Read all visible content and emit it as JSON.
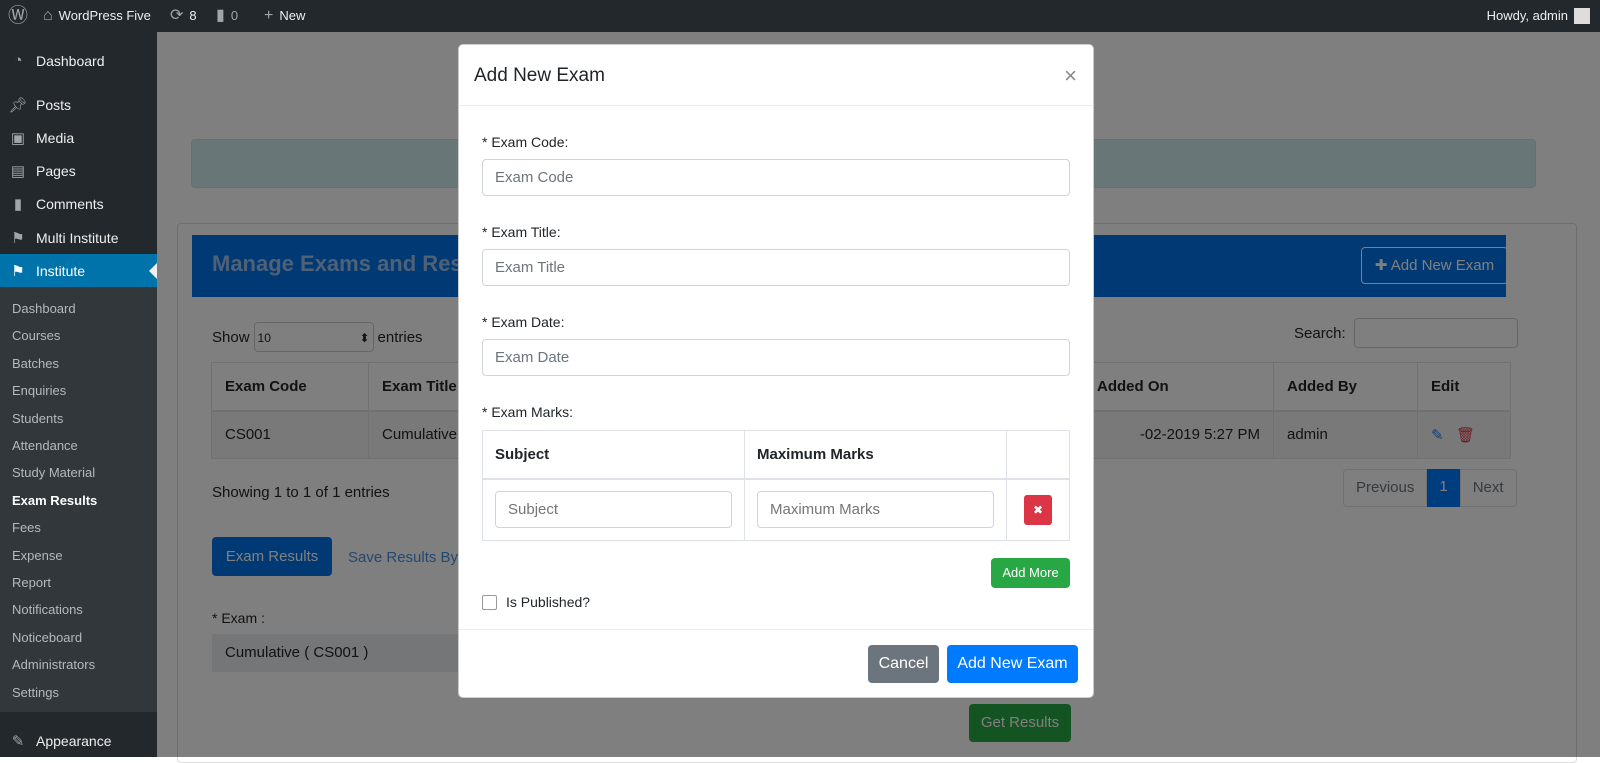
{
  "adminbar": {
    "site": "WordPress Five",
    "updates": "8",
    "comments": "0",
    "new": "New",
    "howdy": "Howdy, admin"
  },
  "sidebar": {
    "items": [
      {
        "label": "Dashboard",
        "icon": "gauge-icon"
      },
      {
        "label": "Posts",
        "icon": "pin-icon"
      },
      {
        "label": "Media",
        "icon": "media-icon"
      },
      {
        "label": "Pages",
        "icon": "pages-icon"
      },
      {
        "label": "Comments",
        "icon": "comment-icon"
      },
      {
        "label": "Multi Institute",
        "icon": "graduation-cap-icon"
      },
      {
        "label": "Institute",
        "icon": "graduation-cap-icon"
      }
    ],
    "submenu": [
      "Dashboard",
      "Courses",
      "Batches",
      "Enquiries",
      "Students",
      "Attendance",
      "Study Material",
      "Exam Results",
      "Fees",
      "Expense",
      "Report",
      "Notifications",
      "Noticeboard",
      "Administrators",
      "Settings"
    ],
    "current": "Exam Results",
    "appearance": "Appearance"
  },
  "page": {
    "header": "Manage Exams and Results",
    "add_button": "Add New Exam",
    "show": "Show",
    "entries_value": "10",
    "entries": "entries",
    "search_label": "Search:",
    "columns": [
      "Exam Code",
      "Exam Title",
      "Added On",
      "Added By",
      "Edit"
    ],
    "rows": [
      {
        "code": "CS001",
        "title": "Cumulative",
        "added_on": "-02-2019 5:27 PM",
        "added_by": "admin"
      }
    ],
    "showing": "Showing 1 to 1 of 1 entries",
    "pagination": {
      "prev": "Previous",
      "page": "1",
      "next": "Next"
    },
    "exam_results_btn": "Exam Results",
    "save_results_link": "Save Results By",
    "exam_label": "* Exam :",
    "exam_value": "Cumulative ( CS001 )",
    "get_results": "Get Results"
  },
  "modal": {
    "title": "Add New Exam",
    "close": "×",
    "code_label": "* Exam Code:",
    "code_ph": "Exam Code",
    "title_label": "* Exam Title:",
    "title_ph": "Exam Title",
    "date_label": "* Exam Date:",
    "date_ph": "Exam Date",
    "marks_label": "* Exam Marks:",
    "subject_col": "Subject",
    "max_col": "Maximum Marks",
    "subject_ph": "Subject",
    "max_ph": "Maximum Marks",
    "remove": "✖",
    "add_more": "Add More",
    "published": "Is Published?",
    "cancel": "Cancel",
    "submit": "Add New Exam"
  }
}
